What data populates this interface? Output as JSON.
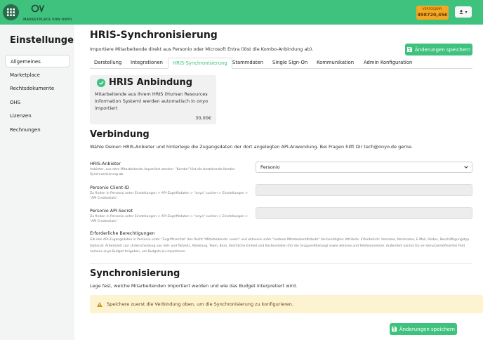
{
  "header": {
    "brand": "MARKETPLACE VON ONYO",
    "budget_label": "VERFÜGBAR:",
    "budget_value": "498720,45€",
    "user_caret": "▾"
  },
  "sidebar": {
    "title": "Einstellungen",
    "items": [
      {
        "label": "Allgemeines"
      },
      {
        "label": "Marketplace"
      },
      {
        "label": "Rechtsdokumente"
      },
      {
        "label": "OHS"
      },
      {
        "label": "Lizenzen"
      },
      {
        "label": "Rechnungen"
      }
    ]
  },
  "main": {
    "title": "HRIS-Synchronisierung",
    "subtitle": "Importiere Mitarbeitende direkt aus Personio oder Microsoft Entra (löst die Kombo-Anbindung ab).",
    "save_label": "Änderungen speichern",
    "tabs": [
      {
        "label": "Darstellung"
      },
      {
        "label": "Integrationen"
      },
      {
        "label": "HRIS-Synchronisierung"
      },
      {
        "label": "Stammdaten"
      },
      {
        "label": "Single Sign-On"
      },
      {
        "label": "Kommunikation"
      },
      {
        "label": "Admin Konfiguration"
      }
    ],
    "card": {
      "title": "HRIS Anbindung",
      "description": "Mitarbeitende aus Ihrem HRIS (Human Resources Information System) werden automatisch in onyo importiert",
      "price": "30,00€"
    },
    "verbindung": {
      "title": "Verbindung",
      "text": "Wähle Deinen HRIS-Anbieter und hinterlege die Zugangsdaten der dort angelegten API-Anwendung. Bei Fragen hilft Dir tech@onyo.de gerne.",
      "provider_label": "HRIS-Anbieter",
      "provider_help": "Anbieter, aus dem Mitarbeitende importiert werden. \"Kombo\" löst die bestehende Kombo-Synchronisierung ab.",
      "provider_value": "Personio",
      "client_id_label": "Personio Client-ID",
      "client_id_help": "Zu finden in Personio unter Einstellungen > API-Zugriffsdaten > \"onyo\" suchen > Einstellungen > \"API Credentials\".",
      "client_id_value": "",
      "secret_label": "Personio API-Secret",
      "secret_help": "Zu finden in Personio unter Einstellungen > API-Zugriffsdaten > \"onyo\" suchen > Einstellungen > \"API Credentials\".",
      "secret_value": "",
      "permissions_label": "Erforderliche Berechtigungen",
      "permissions_text": "Gib den API-Zugangsdaten in Personio unter \"Zugriffsrechte\" das Recht \"Mitarbeitende: Lesen\" und aktiviere unter \"Lesbare Mitarbeiterattribute\" die benötigten Attribute. Erforderlich: Vorname, Nachname, E-Mail, Status, Beschäftigungstyp. Optional: Arbeitszeit (zur Unterscheidung von Voll- und Teilzeit), Abteilung, Team, Büro, Rechtliche Einheit und Kostenstellen (für die Gruppenfilterung) sowie Adresse und Telefonnummer. Außerdem kannst Du ein benutzerdefiniertes Feld namens onyo-Budget freigeben, um Budgets zu importieren."
    },
    "sync": {
      "title": "Synchronisierung",
      "text": "Lege fest, welche Mitarbeitenden importiert werden und wie das Budget interpretiert wird.",
      "alert": "Speichere zuerst die Verbindung oben, um die Synchronisierung zu konfigurieren."
    }
  },
  "colors": {
    "accent": "#3fc27e",
    "budget": "#f5a623",
    "alert_bg": "#fdf3d0"
  }
}
